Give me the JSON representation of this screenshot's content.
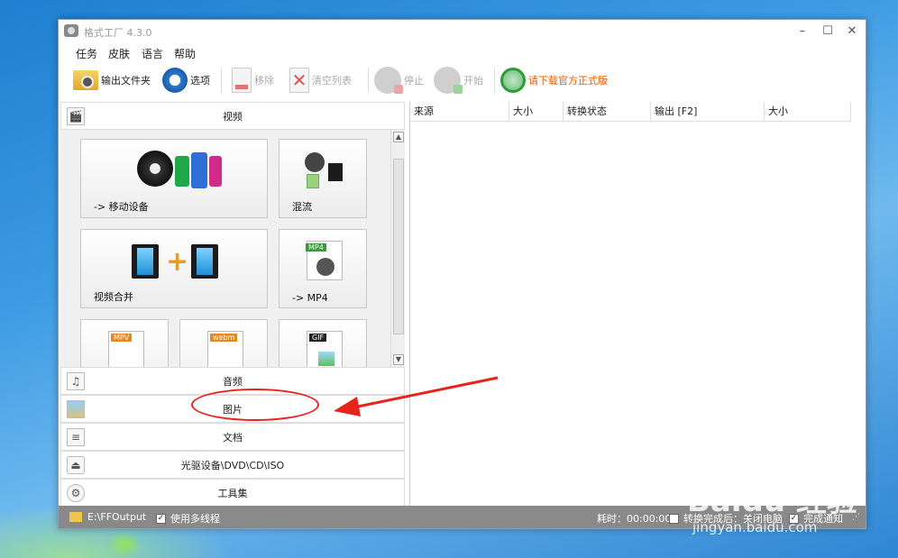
{
  "window": {
    "title": "格式工厂 4.3.0"
  },
  "menu": [
    "任务",
    "皮肤",
    "语言",
    "帮助"
  ],
  "toolbar": {
    "output_folder": "输出文件夹",
    "options": "选项",
    "remove": "移除",
    "clear_list": "清空列表",
    "stop": "停止",
    "start": "开始",
    "download": "请下载官方正式版"
  },
  "left": {
    "video_header": "视频",
    "tiles": {
      "mobile": "-> 移动设备",
      "mix": "混流",
      "merge": "视频合并",
      "mp4": "-> MP4",
      "mp4_badge": "MP4",
      "mpv_badge": "MPV",
      "webm_badge": "webm",
      "gif_badge": "GIF"
    },
    "categories": {
      "audio": "音频",
      "image": "图片",
      "document": "文档",
      "disc": "光驱设备\\DVD\\CD\\ISO",
      "tools": "工具集"
    }
  },
  "table": {
    "columns": [
      "来源",
      "大小",
      "转换状态",
      "输出 [F2]",
      "大小"
    ]
  },
  "status": {
    "path": "E:\\FFOutput",
    "multithread": "使用多线程",
    "time": "耗时：00:00:00",
    "after": "转换完成后：关闭电脑",
    "notify": "完成通知"
  },
  "watermark": {
    "brand": "Baidu 经验",
    "url": "jingyan.baidu.com"
  },
  "colors": {
    "annotation": "#e8231b",
    "download_text": "#e65c00",
    "statusbar": "#898989"
  }
}
